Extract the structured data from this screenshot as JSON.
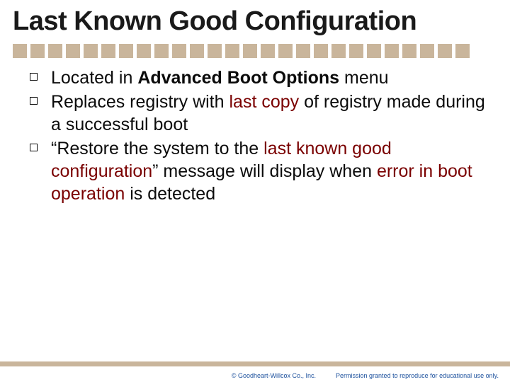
{
  "title": "Last Known Good Configuration",
  "bullets": [
    {
      "pre": "Located in ",
      "bold": "Advanced Boot Options",
      "post": " menu"
    },
    {
      "plain1": "Replaces registry with ",
      "hl1": "last copy",
      "plain2": " of registry made during a successful boot"
    },
    {
      "plain1": "“Restore the system to the ",
      "hl1": "last known good configuration",
      "plain2": "” message will display when ",
      "hl2": "error in boot operation",
      "plain3": " is detected"
    }
  ],
  "footer": {
    "copyright": "© Goodheart-Willcox Co., Inc.",
    "permission": "Permission granted to reproduce for educational use only."
  }
}
